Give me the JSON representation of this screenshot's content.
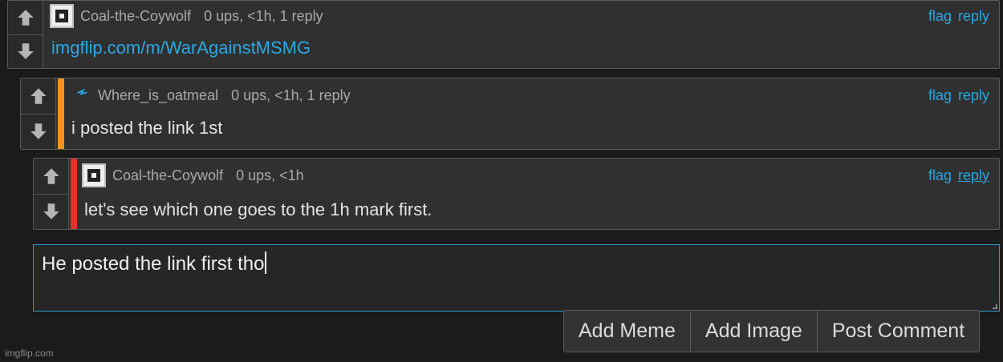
{
  "comments": [
    {
      "username": "Coal-the-Coywolf",
      "meta": "0 ups, <1h, 1 reply",
      "flag_label": "flag",
      "reply_label": "reply",
      "body": "imgflip.com/m/WarAgainstMSMG"
    },
    {
      "username": "Where_is_oatmeal",
      "meta": "0 ups, <1h, 1 reply",
      "flag_label": "flag",
      "reply_label": "reply",
      "body": "i posted the link 1st",
      "bar_color": "#f7941d"
    },
    {
      "username": "Coal-the-Coywolf",
      "meta": "0 ups, <1h",
      "flag_label": "flag",
      "reply_label": "reply",
      "body": "let's see which one goes to the 1h mark first.",
      "bar_color": "#e5322d"
    }
  ],
  "reply_box": {
    "value": "He posted the link first tho"
  },
  "buttons": {
    "add_meme": "Add Meme",
    "add_image": "Add Image",
    "post_comment": "Post Comment"
  },
  "watermark": "imgflip.com",
  "colors": {
    "link": "#27a7e0",
    "accent_border": "#2f9cc9"
  },
  "icons": {
    "upvote": "arrow-up-icon",
    "downvote": "arrow-down-icon"
  }
}
